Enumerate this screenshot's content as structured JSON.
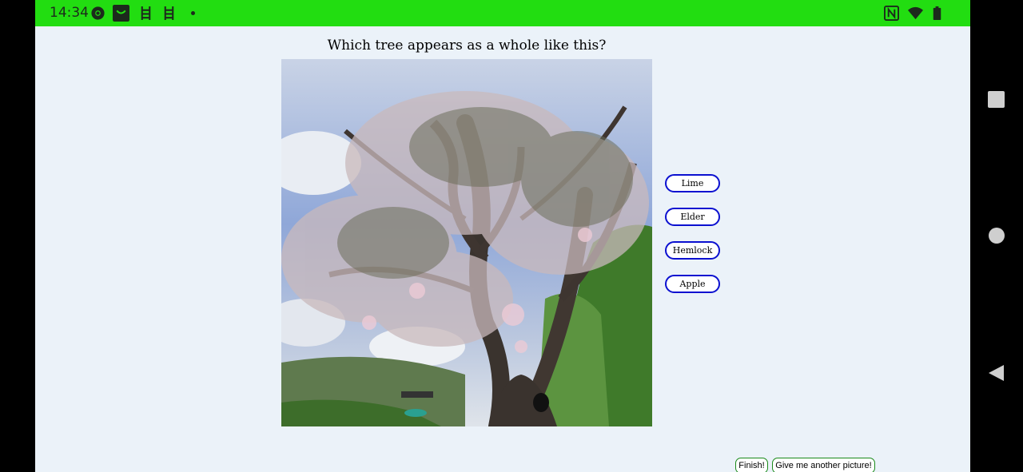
{
  "status_bar": {
    "time": "14:34",
    "left_icons": [
      "chrome-icon",
      "shopping-bag-icon",
      "ladder-icon",
      "ladder-icon"
    ],
    "right_icons": [
      "nfc-icon",
      "wifi-icon",
      "battery-icon"
    ],
    "background": "#22dd11"
  },
  "quiz": {
    "question": "Which tree appears as a whole like this?",
    "answers": [
      "Lime",
      "Elder",
      "Hemlock",
      "Apple"
    ],
    "answer_border_color": "#0b10d0"
  },
  "footer": {
    "finish_label": "Finish!",
    "another_label": "Give me another picture!"
  },
  "navigation": {
    "icons": [
      "recents-icon",
      "home-icon",
      "back-icon"
    ]
  }
}
